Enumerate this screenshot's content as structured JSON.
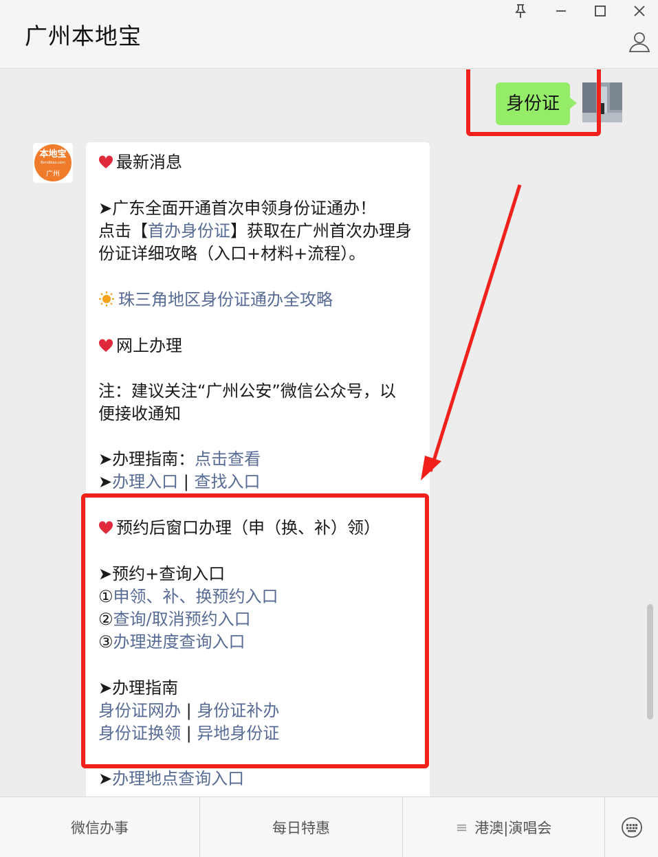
{
  "window": {
    "title": "广州本地宝"
  },
  "chat": {
    "my_message": "身份证",
    "bot_avatar": {
      "logo_text": "本地宝",
      "logo_sub": "Bendibao.com",
      "city": "广州"
    },
    "lines": {
      "latest_news": "最新消息",
      "guangdong_a": "➤广东全面开通首次申领身份证通办！",
      "click_prefix": "点击【",
      "first_id_link": "首办身份证",
      "click_suffix": "】获取在广州首次办理身",
      "detail_line": "份证详细攻略（入口+材料+流程）。",
      "prd_link": "珠三角地区身份证通办全攻略",
      "online": "网上办理",
      "note_a": "注：建议关注“广州公安”微信公众号，以",
      "note_b": "便接收通知",
      "guide_prefix": "➤办理指南：",
      "guide_link": "点击查看",
      "arrow": "➤",
      "entry_link": "办理入口",
      "sep": " | ",
      "find_link": "查找入口",
      "appointment": "预约后窗口办理（申（换、补）领）",
      "appt_query": "➤预约+查询入口",
      "num1": "①",
      "link1": "申领、补、换预约入口",
      "num2": "②",
      "link2": "查询/取消预约入口",
      "num3": "③",
      "link3": "办理进度查询入口",
      "guide2": "➤办理指南",
      "id_online": "身份证网办",
      "id_reissue": "身份证补办",
      "id_renew": "身份证换领",
      "id_remote": "异地身份证",
      "place_link": "办理地点查询入口"
    }
  },
  "bottom_menu": {
    "items": [
      "微信办事",
      "每日特惠",
      "港澳|演唱会"
    ],
    "menu_icon": "≡"
  },
  "colors": {
    "link": "#576b95",
    "bubble_me": "#95ec69",
    "highlight": "#f2211b"
  },
  "icons": [
    "pin-icon",
    "minimize-icon",
    "maximize-icon",
    "close-icon",
    "person-icon",
    "heart-icon",
    "sun-icon",
    "keyboard-icon"
  ]
}
